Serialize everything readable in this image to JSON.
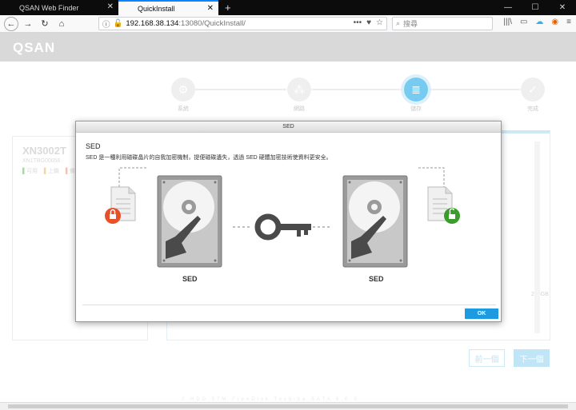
{
  "browser": {
    "tabs": [
      {
        "title": "QSAN Web Finder",
        "active": false
      },
      {
        "title": "QuickInstall",
        "active": true
      }
    ],
    "url_host": "192.168.38.134",
    "url_rest": ":13080/QuickInstall/",
    "search_placeholder": "搜尋"
  },
  "app": {
    "logo": "QSAN",
    "steps": [
      {
        "label": "系統",
        "icon": "gear-icon"
      },
      {
        "label": "網路",
        "icon": "network-icon"
      },
      {
        "label": "儲存",
        "icon": "database-icon",
        "active": true
      },
      {
        "label": "完成",
        "icon": "check-icon"
      }
    ],
    "device": {
      "model": "XN3002T",
      "serial": "XN1TBG00056",
      "legend": [
        "可用",
        "上鎖",
        "備"
      ]
    },
    "table_hint": {
      "size": "236GB",
      "row": "2  HDD  57M  FreeDisk  Toshiba  SATA 6.0 G"
    },
    "buttons": {
      "prev": "前一個",
      "next": "下一個"
    }
  },
  "modal": {
    "title": "SED",
    "heading": "SED",
    "description": "SED 是一種利用磁碟晶片的自我加密機制，提便磁碟遺失，透過 SED 硬體加密技術使資料更安全。",
    "left_label": "SED",
    "right_label": "SED",
    "ok_label": "OK"
  },
  "colors": {
    "accent": "#2fb0e8",
    "ok_button": "#1e9be0",
    "lock_red": "#e8502a",
    "unlock_green": "#3a9c2a"
  }
}
